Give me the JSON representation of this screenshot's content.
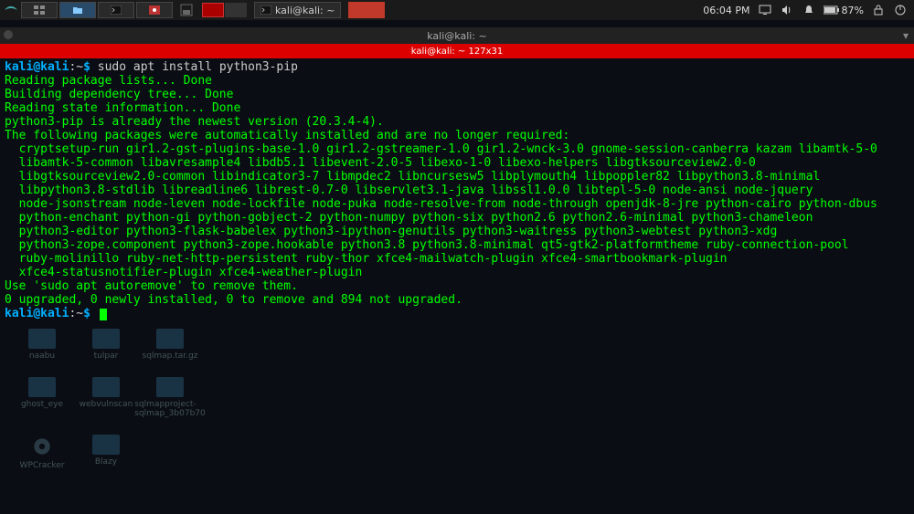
{
  "taskbar": {
    "window_title": "kali@kali: ~",
    "clock": "06:04 PM",
    "battery": "87%"
  },
  "terminal": {
    "titlebar": "kali@kali: ~",
    "tab": "kali@kali: ~ 127x31",
    "prompt": {
      "user": "kali",
      "at": "@",
      "host": "kali",
      "colon": ":",
      "path": "~",
      "dollar": "$"
    },
    "command": "sudo apt install python3-pip",
    "lines": [
      "Reading package lists... Done",
      "Building dependency tree... Done",
      "Reading state information... Done",
      "python3-pip is already the newest version (20.3.4-4).",
      "The following packages were automatically installed and are no longer required:",
      "  cryptsetup-run gir1.2-gst-plugins-base-1.0 gir1.2-gstreamer-1.0 gir1.2-wnck-3.0 gnome-session-canberra kazam libamtk-5-0",
      "  libamtk-5-common libavresample4 libdb5.1 libevent-2.0-5 libexo-1-0 libexo-helpers libgtksourceview2.0-0",
      "  libgtksourceview2.0-common libindicator3-7 libmpdec2 libncursesw5 libplymouth4 libpoppler82 libpython3.8-minimal",
      "  libpython3.8-stdlib libreadline6 librest-0.7-0 libservlet3.1-java libssl1.0.0 libtepl-5-0 node-ansi node-jquery",
      "  node-jsonstream node-leven node-lockfile node-puka node-resolve-from node-through openjdk-8-jre python-cairo python-dbus",
      "  python-enchant python-gi python-gobject-2 python-numpy python-six python2.6 python2.6-minimal python3-chameleon",
      "  python3-editor python3-flask-babelex python3-ipython-genutils python3-waitress python3-webtest python3-xdg",
      "  python3-zope.component python3-zope.hookable python3.8 python3.8-minimal qt5-gtk2-platformtheme ruby-connection-pool",
      "  ruby-molinillo ruby-net-http-persistent ruby-thor xfce4-mailwatch-plugin xfce4-smartbookmark-plugin",
      "  xfce4-statusnotifier-plugin xfce4-weather-plugin",
      "Use 'sudo apt autoremove' to remove them.",
      "0 upgraded, 0 newly installed, 0 to remove and 894 not upgraded."
    ]
  },
  "desktop": {
    "icons": [
      {
        "label": "naabu",
        "type": "folder"
      },
      {
        "label": "tulpar",
        "type": "folder"
      },
      {
        "label": "sqlmap.tar.gz",
        "type": "file"
      },
      {
        "label": "ghost_eye",
        "type": "folder"
      },
      {
        "label": "webvulnscan",
        "type": "folder"
      },
      {
        "label": "sqlmapproject-sqlmap_3b07b70",
        "type": "folder"
      },
      {
        "label": "WPCracker",
        "type": "gear"
      },
      {
        "label": "Blazy",
        "type": "folder"
      }
    ]
  }
}
